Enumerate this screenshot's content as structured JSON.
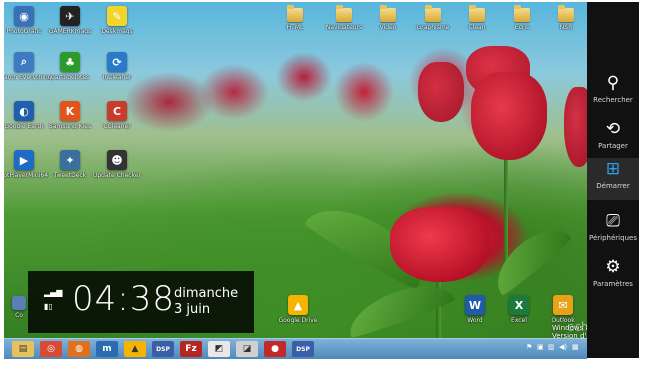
{
  "desktop_icons": [
    {
      "label": "PhotoGrafic",
      "color": "#3b6fb6",
      "glyph": "◉"
    },
    {
      "label": "GAMERKmags",
      "color": "#222222",
      "glyph": "✈"
    },
    {
      "label": "Deskmags",
      "color": "#f2d52b",
      "glyph": "✎"
    },
    {
      "label": "Search Everything",
      "color": "#3e7bc2",
      "glyph": "⌕"
    },
    {
      "label": "Cartobelotes",
      "color": "#2d9a2d",
      "glyph": "♣"
    },
    {
      "label": "InCleaner",
      "color": "#2b7ac9",
      "glyph": "⟳"
    },
    {
      "label": "Google Earth",
      "color": "#1f5fae",
      "glyph": "◐"
    },
    {
      "label": "Samsung Kies",
      "color": "#e0551b",
      "glyph": "K"
    },
    {
      "label": "CCleaner",
      "color": "#c93b2a",
      "glyph": "C"
    },
    {
      "label": "PotPlayerMini64",
      "color": "#1d6bc5",
      "glyph": "▶"
    },
    {
      "label": "TweetDeck",
      "color": "#3a6f9e",
      "glyph": "✦"
    },
    {
      "label": "Update Checker",
      "color": "#333333",
      "glyph": "☻"
    }
  ],
  "folders": [
    "HTML",
    "Navigateurs",
    "Vidéo",
    "Graphisme",
    "Clean",
    "Ecris",
    "NSR"
  ],
  "bottom_icons": [
    {
      "label": "Google Drive",
      "color": "#f4b400",
      "glyph": "▲"
    },
    {
      "label": "Word",
      "color": "#1e5ba8",
      "glyph": "W"
    },
    {
      "label": "Excel",
      "color": "#1e7a3c",
      "glyph": "X"
    },
    {
      "label": "Outlook",
      "color": "#e8a21a",
      "glyph": "✉"
    }
  ],
  "bottom_left_label": "Co",
  "charms": [
    {
      "label": "Rechercher",
      "icon": "search-icon",
      "glyph": "⚲"
    },
    {
      "label": "Partager",
      "icon": "share-icon",
      "glyph": "⟲"
    },
    {
      "label": "Démarrer",
      "icon": "windows-icon",
      "glyph": "⊞"
    },
    {
      "label": "Périphériques",
      "icon": "devices-icon",
      "glyph": "⎚"
    },
    {
      "label": "Paramètres",
      "icon": "gear-icon",
      "glyph": "⚙"
    }
  ],
  "clock": {
    "time": "04:38",
    "day": "dimanche",
    "date": "3 juin"
  },
  "watermark": "ech",
  "eval_text": [
    "Windows 8 I",
    "Version d'évalua"
  ],
  "taskbar_apps": [
    {
      "name": "file-explorer",
      "color": "#e7c25a",
      "glyph": "▤"
    },
    {
      "name": "chrome",
      "color": "#d94a32",
      "glyph": "◎"
    },
    {
      "name": "firefox",
      "color": "#e1701d",
      "glyph": "◍"
    },
    {
      "name": "app-m",
      "color": "#2b6cb0",
      "glyph": "m"
    },
    {
      "name": "google-drive",
      "color": "#f4b400",
      "glyph": "▲"
    },
    {
      "name": "dsp",
      "color": "#3b5fa6",
      "glyph": "DSP"
    },
    {
      "name": "filezilla",
      "color": "#b5261e",
      "glyph": "Fz"
    },
    {
      "name": "app-r",
      "color": "#e8e8e8",
      "glyph": "◩"
    },
    {
      "name": "app-g",
      "color": "#d0d0d0",
      "glyph": "◪"
    },
    {
      "name": "app-record",
      "color": "#c22a2a",
      "glyph": "●"
    },
    {
      "name": "dsp2",
      "color": "#3b5fa6",
      "glyph": "DSP"
    }
  ]
}
